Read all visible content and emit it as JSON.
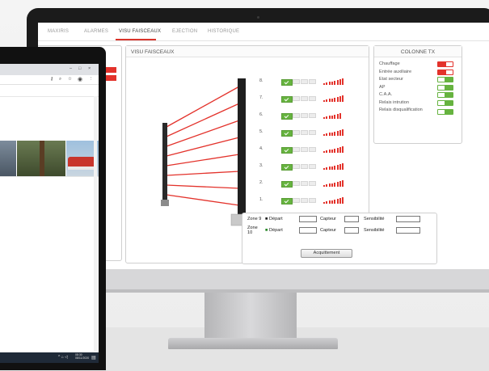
{
  "tabs": [
    {
      "label": "MAXIRIS",
      "active": false
    },
    {
      "label": "ALARMES",
      "active": false
    },
    {
      "label": "VISU FAISCEAUX",
      "active": true
    },
    {
      "label": "EJECTION",
      "active": false
    },
    {
      "label": "HISTORIQUE",
      "active": false
    }
  ],
  "visu": {
    "title": "VISU FAISCEAUX"
  },
  "tx": {
    "title": "COLONNE TX",
    "items": [
      {
        "label": "Chauffage",
        "state": "off",
        "color": "#e3322b"
      },
      {
        "label": "Entrée auxiliaire",
        "state": "off",
        "color": "#e3322b"
      },
      {
        "label": "Etat secteur",
        "state": "on",
        "color": "#66b33f"
      },
      {
        "label": "AP",
        "state": "on",
        "color": "#66b33f"
      },
      {
        "label": "C.A.A.",
        "state": "on",
        "color": "#66b33f"
      },
      {
        "label": "Relais intrution",
        "state": "on",
        "color": "#66b33f"
      },
      {
        "label": "Relais disqualification",
        "state": "on",
        "color": "#66b33f"
      }
    ]
  },
  "beams": [
    {
      "num": "8.",
      "ok": true,
      "signal": 8
    },
    {
      "num": "7.",
      "ok": true,
      "signal": 8
    },
    {
      "num": "6.",
      "ok": true,
      "signal": 7
    },
    {
      "num": "5.",
      "ok": true,
      "signal": 8
    },
    {
      "num": "4.",
      "ok": true,
      "signal": 8
    },
    {
      "num": "3.",
      "ok": true,
      "signal": 8
    },
    {
      "num": "2.",
      "ok": true,
      "signal": 8
    },
    {
      "num": "1.",
      "ok": true,
      "signal": 8
    }
  ],
  "zones": [
    {
      "name": "Zone 9",
      "depart": "Départ",
      "capteur": "Capteur",
      "sensibilite": "Sensibilité"
    },
    {
      "name": "Zone 10",
      "depart": "Départ",
      "capteur": "Capteur",
      "sensibilite": "Sensibilité"
    }
  ],
  "ack_label": "Acquittement",
  "laptop": {
    "window_controls": {
      "minimize": "–",
      "maximize": "□",
      "close": "×"
    },
    "clock": {
      "time": "08:30",
      "date": "08/11/2020"
    }
  },
  "colors": {
    "accent_red": "#e3322b",
    "ok_green": "#66b33f"
  }
}
